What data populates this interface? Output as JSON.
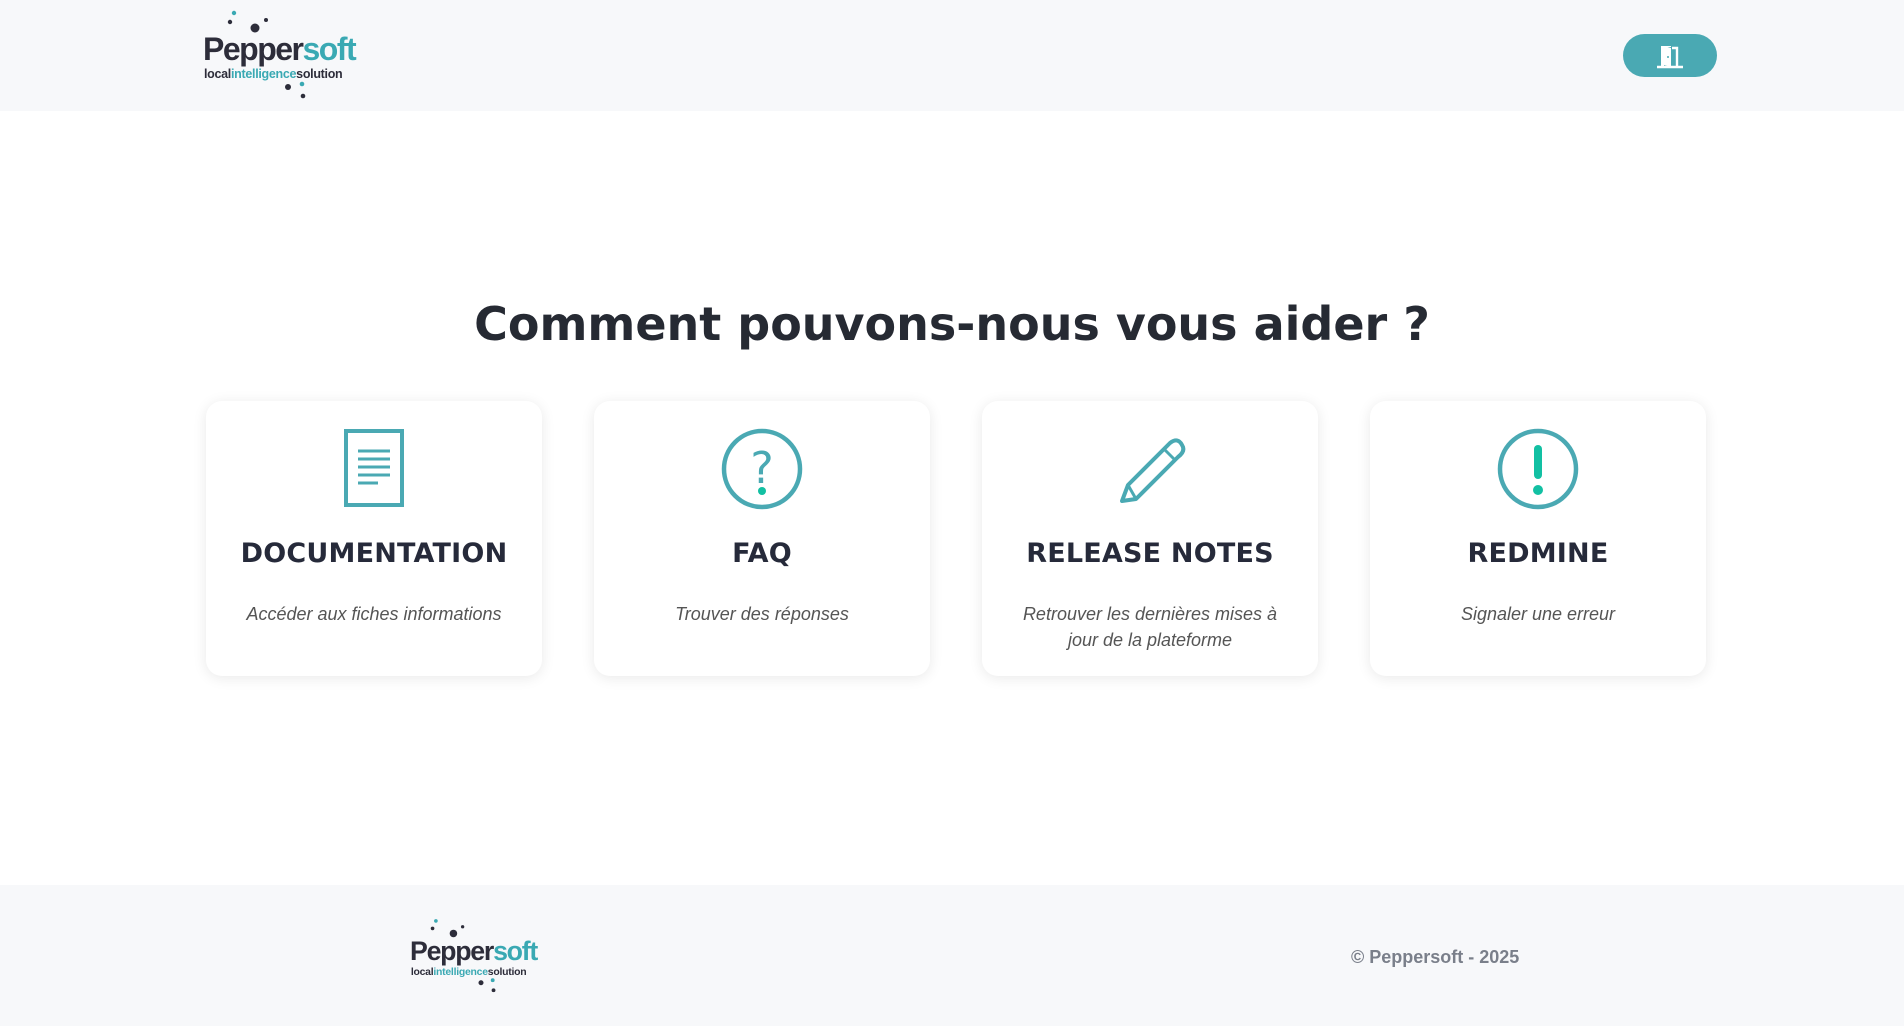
{
  "header": {
    "logo": {
      "brand_main": "Pepper",
      "brand_accent": "soft",
      "tagline_a": "local",
      "tagline_b": "intelligence",
      "tagline_c": "solution"
    },
    "exit_icon": "door-exit-icon"
  },
  "main": {
    "title": "Comment pouvons-nous vous aider ?",
    "cards": [
      {
        "icon": "document-icon",
        "title": "DOCUMENTATION",
        "description": "Accéder aux fiches informations"
      },
      {
        "icon": "question-circle-icon",
        "title": "FAQ",
        "description": "Trouver des réponses"
      },
      {
        "icon": "pencil-icon",
        "title": "RELEASE NOTES",
        "description": "Retrouver les dernières mises à jour de la plateforme"
      },
      {
        "icon": "exclamation-circle-icon",
        "title": "REDMINE",
        "description": "Signaler une erreur"
      }
    ]
  },
  "footer": {
    "logo": {
      "brand_main": "Pepper",
      "brand_accent": "soft",
      "tagline_a": "local",
      "tagline_b": "intelligence",
      "tagline_c": "solution"
    },
    "copyright": "© Peppersoft - 2025"
  },
  "colors": {
    "accent": "#4aa9b3",
    "teal_logo": "#3aa9b3",
    "dark": "#262a33",
    "header_bg": "#f7f8fa"
  }
}
